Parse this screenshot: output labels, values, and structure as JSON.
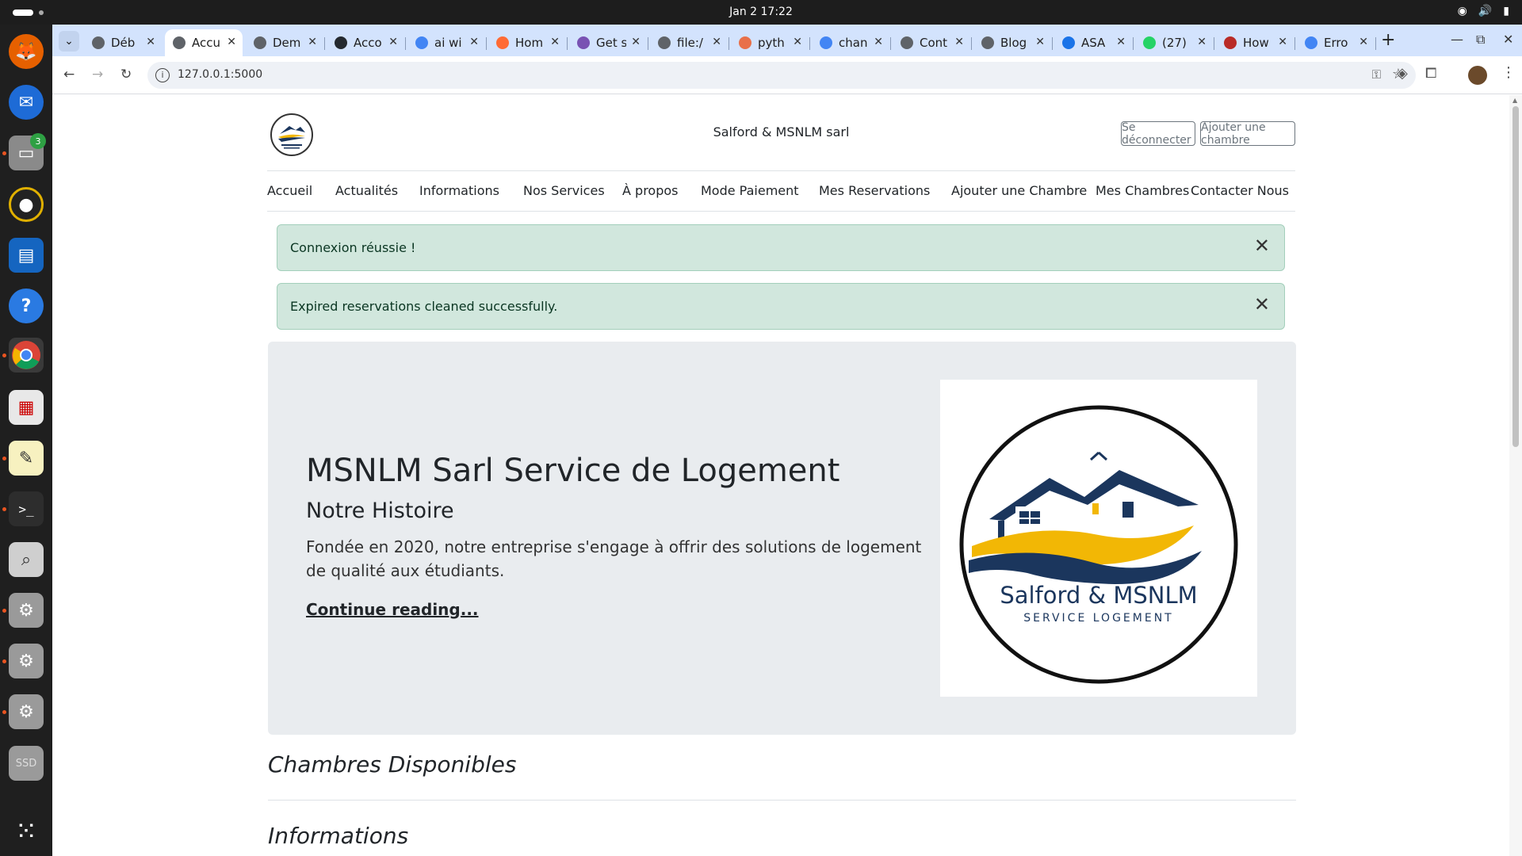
{
  "topbar": {
    "clock": "Jan 2  17:22"
  },
  "browser": {
    "tabs": [
      {
        "title": "Déb",
        "color": "#5f6368"
      },
      {
        "title": "Accu",
        "color": "#5f6368",
        "active": true
      },
      {
        "title": "Dem",
        "color": "#5f6368"
      },
      {
        "title": "Acco",
        "color": "#24292f"
      },
      {
        "title": "ai wi",
        "color": "#4285f4"
      },
      {
        "title": "Hom",
        "color": "#ff6b35"
      },
      {
        "title": "Get s",
        "color": "#7952b3"
      },
      {
        "title": "file:/",
        "color": "#5f6368"
      },
      {
        "title": "pyth",
        "color": "#e8704a"
      },
      {
        "title": "chan",
        "color": "#4285f4"
      },
      {
        "title": "Cont",
        "color": "#5f6368"
      },
      {
        "title": "Blog",
        "color": "#5f6368"
      },
      {
        "title": "ASA",
        "color": "#1a73e8"
      },
      {
        "title": "(27)",
        "color": "#25d366"
      },
      {
        "title": "How",
        "color": "#b92b27"
      },
      {
        "title": "Erro",
        "color": "#4285f4"
      }
    ],
    "url": "127.0.0.1:5000"
  },
  "site": {
    "title": "Salford & MSNLM sarl",
    "logout_label": "Se déconnecter",
    "add_room_label": "Ajouter une chambre",
    "nav": [
      "Accueil",
      "Actualités",
      "Informations",
      "Nos Services",
      "À propos",
      "Mode Paiement",
      "Mes Reservations",
      "Ajouter une Chambre",
      "Mes Chambres",
      "Contacter Nous"
    ],
    "alerts": [
      "Connexion réussie !",
      "Expired reservations cleaned successfully."
    ],
    "hero": {
      "title": "MSNLM Sarl Service de Logement",
      "subtitle": "Notre Histoire",
      "text": "Fondée en 2020, notre entreprise s'engage à offrir des solutions de logement de qualité aux étudiants.",
      "link": "Continue reading...",
      "logo_line1": "Salford & MSNLM",
      "logo_line2": "SERVICE LOGEMENT"
    },
    "sections": [
      "Chambres Disponibles",
      "Informations"
    ]
  },
  "colors": {
    "alert_bg": "#d1e7dd",
    "hero_bg": "#e9ecef",
    "logo_navy": "#1b365d",
    "logo_gold": "#f2b705"
  }
}
